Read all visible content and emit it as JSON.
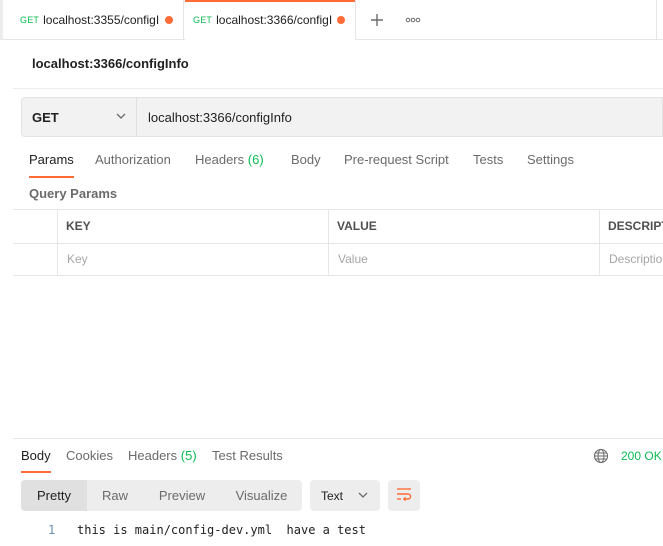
{
  "tabs": [
    {
      "method": "GET",
      "title": "localhost:3355/configI"
    },
    {
      "method": "GET",
      "title": "localhost:3366/configI"
    }
  ],
  "new_tab_icon": "plus-icon",
  "more_tabs_icon": "ellipsis-icon",
  "request": {
    "name": "localhost:3366/configInfo",
    "method": "GET",
    "url": "localhost:3366/configInfo"
  },
  "request_tabs": {
    "params": "Params",
    "authorization": "Authorization",
    "headers": "Headers",
    "headers_count": "(6)",
    "body": "Body",
    "pre_request": "Pre-request Script",
    "tests": "Tests",
    "settings": "Settings"
  },
  "query_params": {
    "label": "Query Params",
    "columns": {
      "key": "KEY",
      "value": "VALUE",
      "description": "DESCRIPT"
    },
    "placeholders": {
      "key": "Key",
      "value": "Value",
      "description": "Descriptio"
    }
  },
  "response": {
    "tabs": {
      "body": "Body",
      "cookies": "Cookies",
      "headers": "Headers",
      "headers_count": "(5)",
      "test_results": "Test Results"
    },
    "status": "200 OK",
    "views": [
      "Pretty",
      "Raw",
      "Preview",
      "Visualize"
    ],
    "format": "Text",
    "lines": [
      {
        "number": "1",
        "text": "this is main/config-dev.yml  have a test"
      }
    ]
  },
  "colors": {
    "accent": "#ff6c37",
    "get_method": "#0cbb52",
    "status_ok": "#0cbb52"
  }
}
